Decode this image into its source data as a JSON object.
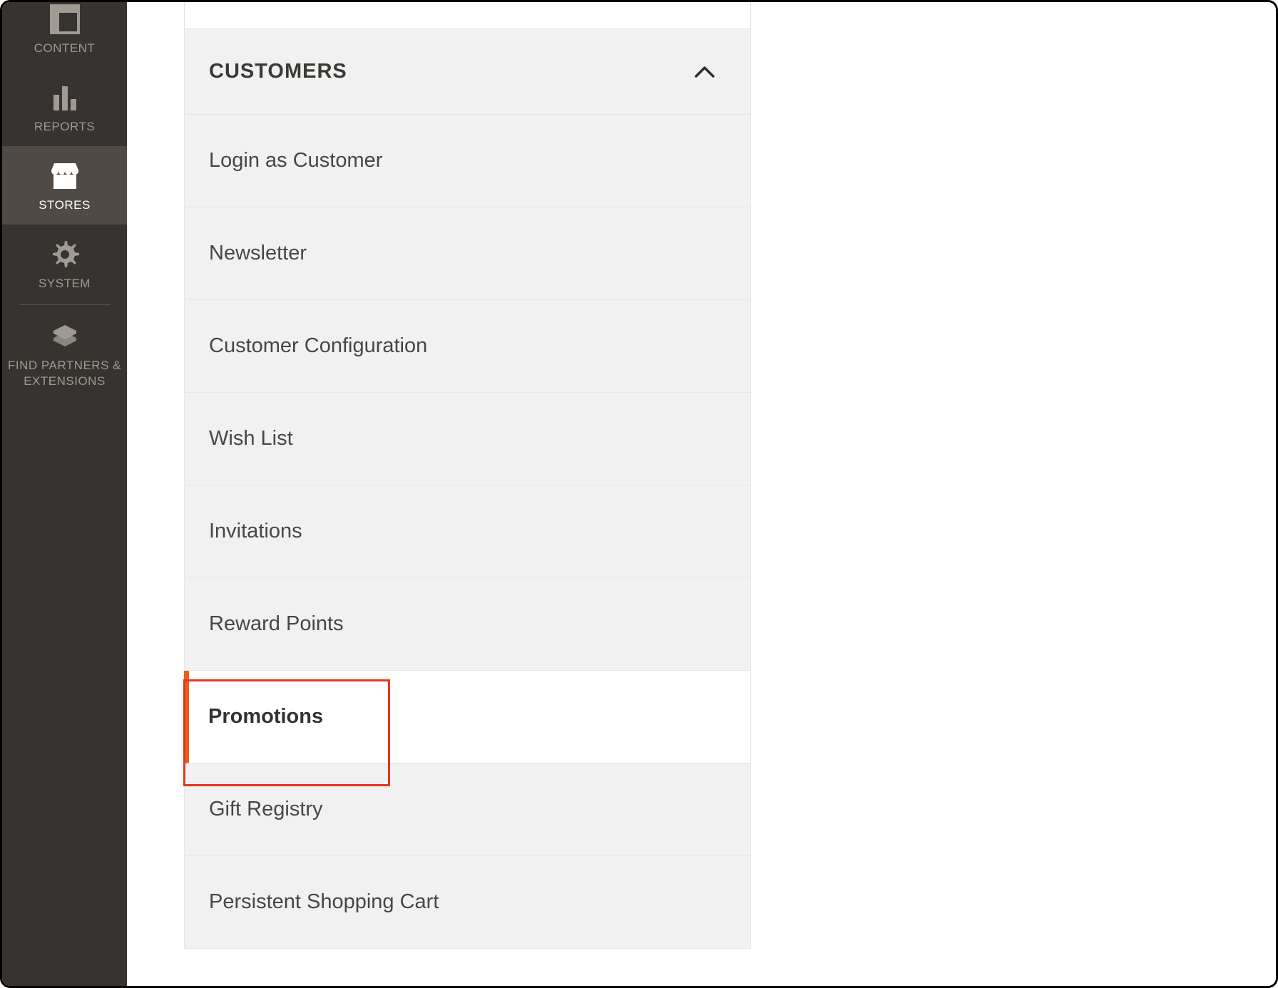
{
  "sidebar": {
    "items": [
      {
        "label": "CONTENT"
      },
      {
        "label": "REPORTS"
      },
      {
        "label": "STORES"
      },
      {
        "label": "SYSTEM"
      },
      {
        "label": "FIND PARTNERS & EXTENSIONS"
      }
    ]
  },
  "section": {
    "title": "CUSTOMERS",
    "items": [
      {
        "label": "Login as Customer"
      },
      {
        "label": "Newsletter"
      },
      {
        "label": "Customer Configuration"
      },
      {
        "label": "Wish List"
      },
      {
        "label": "Invitations"
      },
      {
        "label": "Reward Points"
      },
      {
        "label": "Promotions"
      },
      {
        "label": "Gift Registry"
      },
      {
        "label": "Persistent Shopping Cart"
      }
    ]
  },
  "colors": {
    "accent": "#e9601a",
    "highlight": "#e2371f",
    "sidebar_bg": "#373330",
    "panel_bg": "#f1f1f1"
  }
}
